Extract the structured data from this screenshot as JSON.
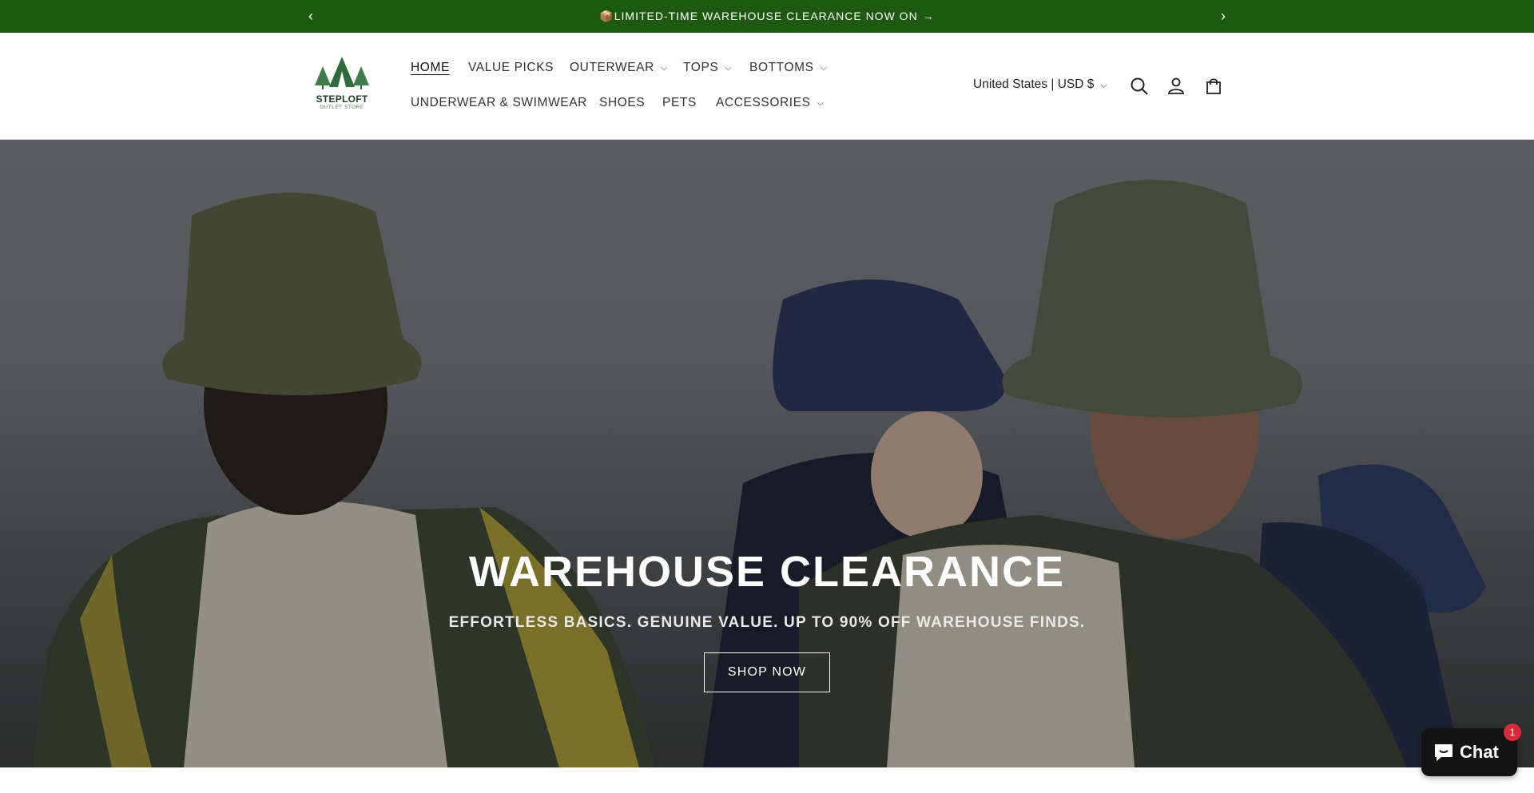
{
  "announcement": {
    "text": "📦LIMITED-TIME WAREHOUSE CLEARANCE NOW ON",
    "arrow_glyph": "→",
    "prev_glyph": "‹",
    "next_glyph": "›",
    "background": "#1d5a0f"
  },
  "logo": {
    "name": "STEPLOFT",
    "tagline": "OUTLET STORE",
    "color": "#2f6b3a"
  },
  "nav": {
    "items": [
      {
        "label": "HOME",
        "active": true
      },
      {
        "label": "VALUE PICKS"
      },
      {
        "label": "OUTERWEAR",
        "dropdown": true
      },
      {
        "label": "TOPS",
        "dropdown": true
      },
      {
        "label": "BOTTOMS",
        "dropdown": true
      },
      {
        "label": "UNDERWEAR & SWIMWEAR"
      },
      {
        "label": "SHOES"
      },
      {
        "label": "PETS"
      },
      {
        "label": "ACCESSORIES",
        "dropdown": true
      }
    ],
    "chevron_glyph": "⌄"
  },
  "header": {
    "region_label": "United States | USD $",
    "icons": [
      "search-icon",
      "account-icon",
      "cart-icon"
    ]
  },
  "hero": {
    "title": "WAREHOUSE CLEARANCE",
    "subtitle": "EFFORTLESS BASICS. GENUINE VALUE. UP TO 90% OFF WAREHOUSE FINDS.",
    "button_label": "SHOP NOW"
  },
  "chat": {
    "label": "Chat",
    "badge_count": "1"
  }
}
